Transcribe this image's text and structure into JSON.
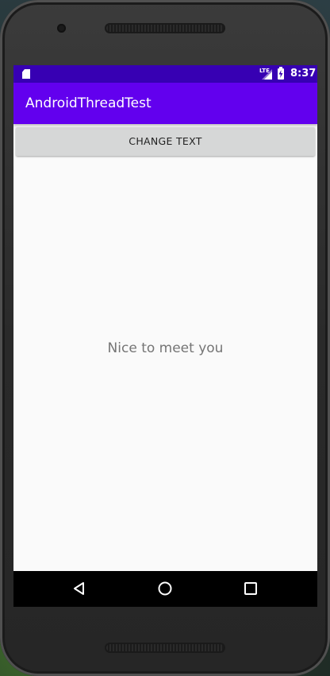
{
  "status_bar": {
    "time": "8:37",
    "network_label": "LTE",
    "icons": [
      "sd-card-icon",
      "lte-signal-icon",
      "battery-charging-icon"
    ]
  },
  "app_bar": {
    "title": "AndroidThreadTest"
  },
  "main": {
    "button_label": "CHANGE TEXT",
    "message": "Nice to meet you"
  },
  "nav_bar": {
    "icons": [
      "back-icon",
      "home-icon",
      "recents-icon"
    ]
  },
  "colors": {
    "status_bar": "#3700b3",
    "app_bar": "#6200ee",
    "button": "#d6d7d7",
    "background": "#fafafa",
    "message_text": "#757575"
  }
}
